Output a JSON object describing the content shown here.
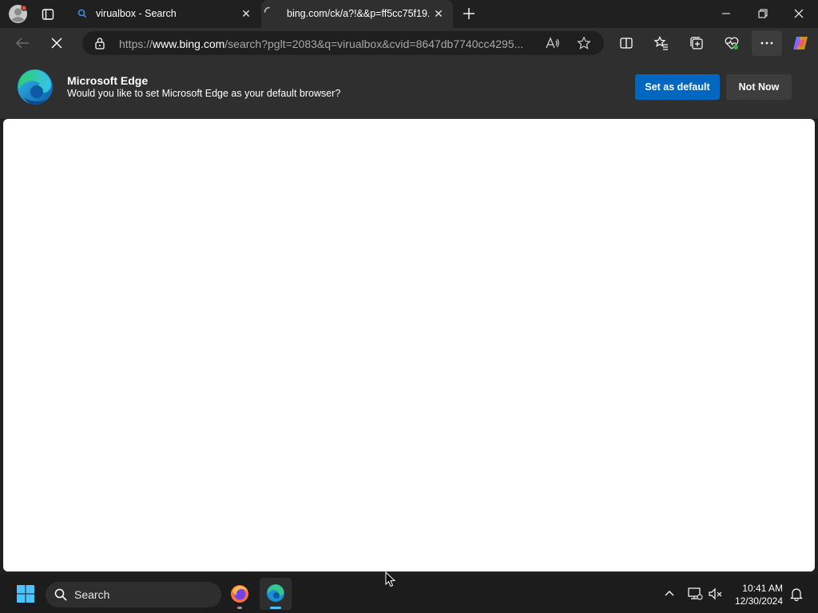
{
  "browser": {
    "tabs": [
      {
        "title": "virualbox - Search",
        "active": false
      },
      {
        "title": "bing.com/ck/a?!&&p=ff5cc75f19...",
        "active": true
      }
    ],
    "address": {
      "url_prefix": "https://",
      "url_domain": "www.bing.com",
      "url_rest": "/search?pglt=2083&q=virualbox&cvid=8647db7740cc4295..."
    }
  },
  "banner": {
    "title": "Microsoft Edge",
    "message": "Would you like to set Microsoft Edge as your default browser?",
    "primary_label": "Set as default",
    "secondary_label": "Not Now"
  },
  "taskbar": {
    "search_label": "Search",
    "time": "10:41 AM",
    "date": "12/30/2024"
  },
  "colors": {
    "accent": "#0067c0",
    "chrome_bg": "#2f2f2f",
    "tabstrip_bg": "#202020",
    "taskbar_bg": "#1c1c1c"
  }
}
